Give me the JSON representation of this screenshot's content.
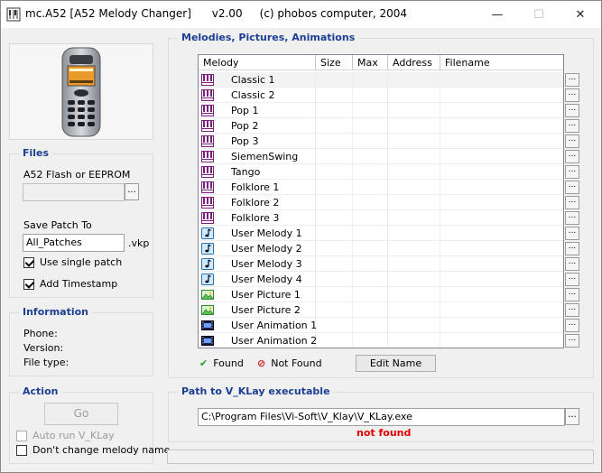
{
  "window": {
    "title": "mc.A52 [A52 Melody Changer]      v2.00     (c) phobos computer, 2004",
    "minimize_glyph": "—",
    "maximize_glyph": "☐",
    "close_glyph": "✕"
  },
  "files": {
    "title": "Files",
    "flash_label": "A52 Flash or EEPROM",
    "flash_value": "",
    "browse_label": "...",
    "save_label": "Save Patch To",
    "save_value": "All_Patches",
    "ext_label": ".vkp",
    "single_patch_label": "Use single patch",
    "single_patch_checked": true,
    "timestamp_label": "Add Timestamp",
    "timestamp_checked": true
  },
  "information": {
    "title": "Information",
    "phone_label": "Phone:",
    "version_label": "Version:",
    "filetype_label": "File type:"
  },
  "action": {
    "title": "Action",
    "go_label": "Go",
    "autorun_label": "Auto run V_KLay",
    "autorun_checked": false,
    "keepname_label": "Don't change melody name",
    "keepname_checked": false
  },
  "melodies": {
    "title": "Melodies, Pictures, Animations",
    "columns": [
      "Melody",
      "Size",
      "Max",
      "Address",
      "Filename"
    ],
    "row_button_label": "...",
    "items": [
      {
        "name": "Classic 1",
        "icon": "piano-icon"
      },
      {
        "name": "Classic 2",
        "icon": "piano-icon"
      },
      {
        "name": "Pop 1",
        "icon": "piano-icon"
      },
      {
        "name": "Pop 2",
        "icon": "piano-icon"
      },
      {
        "name": "Pop 3",
        "icon": "piano-icon"
      },
      {
        "name": "SiemenSwing",
        "icon": "piano-icon"
      },
      {
        "name": "Tango",
        "icon": "piano-icon"
      },
      {
        "name": "Folklore 1",
        "icon": "piano-icon"
      },
      {
        "name": "Folklore 2",
        "icon": "piano-icon"
      },
      {
        "name": "Folklore 3",
        "icon": "piano-icon"
      },
      {
        "name": "User Melody 1",
        "icon": "music-note-icon"
      },
      {
        "name": "User Melody 2",
        "icon": "music-note-icon"
      },
      {
        "name": "User Melody 3",
        "icon": "music-note-icon"
      },
      {
        "name": "User Melody 4",
        "icon": "music-note-icon"
      },
      {
        "name": "User Picture 1",
        "icon": "picture-icon"
      },
      {
        "name": "User Picture 2",
        "icon": "picture-icon"
      },
      {
        "name": "User Animation 1",
        "icon": "film-icon"
      },
      {
        "name": "User Animation 2",
        "icon": "film-icon"
      }
    ],
    "found_label": "Found",
    "not_found_label": "Not Found",
    "edit_name_label": "Edit Name"
  },
  "vklay": {
    "title": "Path to V_KLay executable",
    "path_value": "C:\\Program Files\\Vi-Soft\\V_Klay\\V_KLay.exe",
    "browse_label": "...",
    "status": "not found"
  },
  "colors": {
    "group_title": "#1c3f94",
    "error": "#e00000",
    "found": "#2a9d2a",
    "not_found": "#d02020"
  }
}
